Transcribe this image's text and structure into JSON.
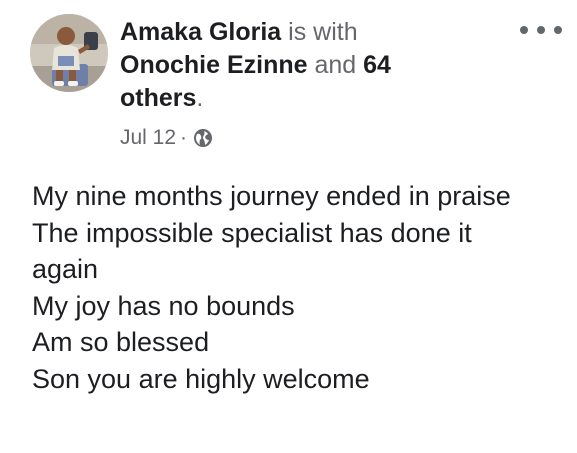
{
  "post": {
    "author": "Amaka Gloria",
    "is_with_text": "is with",
    "tagged_name": "Onochie Ezinne",
    "and_text": "and",
    "others_text": "64 others",
    "period": ".",
    "date": "Jul 12",
    "separator": "·",
    "privacy_icon": "globe-icon",
    "more_icon": "more-options-icon",
    "lines": [
      "My nine months journey ended in praise",
      "The impossible specialist has done it",
      "again",
      "My joy has no bounds",
      "Am so blessed",
      "Son you are highly welcome"
    ]
  },
  "colors": {
    "text": "#1c1e21",
    "muted": "#65676b",
    "icon": "#606770",
    "background": "#ffffff"
  }
}
